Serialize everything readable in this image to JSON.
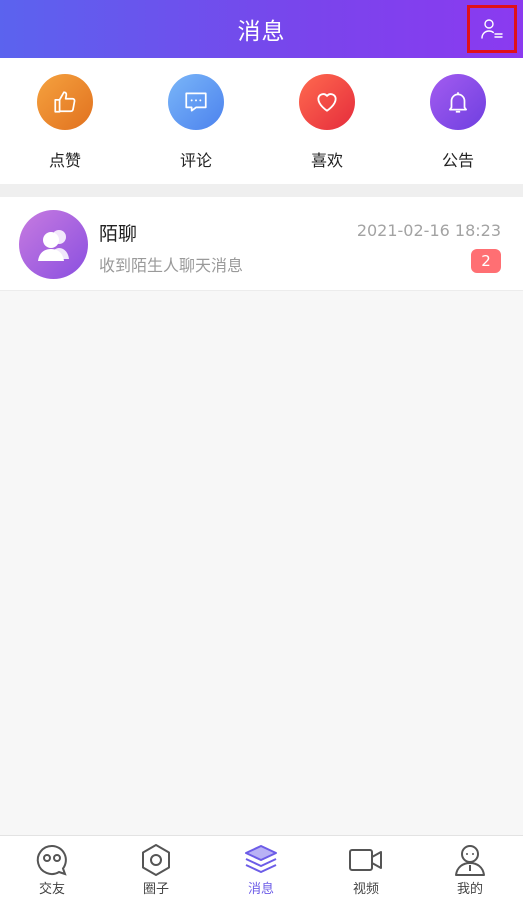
{
  "header": {
    "title": "消息"
  },
  "quick_actions": [
    {
      "label": "点赞",
      "icon": "thumbs-up-icon",
      "color": "#ef8a2e"
    },
    {
      "label": "评论",
      "icon": "comment-icon",
      "color": "#5b9cf5"
    },
    {
      "label": "喜欢",
      "icon": "heart-icon",
      "color": "#f2453d"
    },
    {
      "label": "公告",
      "icon": "bell-icon",
      "color": "#8b4be8"
    }
  ],
  "messages": [
    {
      "title": "陌聊",
      "subtitle": "收到陌生人聊天消息",
      "time": "2021-02-16 18:23",
      "badge": "2",
      "icon": "users-icon"
    }
  ],
  "tabbar": {
    "items": [
      {
        "label": "交友",
        "icon": "chat-face-icon",
        "active": false
      },
      {
        "label": "圈子",
        "icon": "hexagon-icon",
        "active": false
      },
      {
        "label": "消息",
        "icon": "layers-icon",
        "active": true
      },
      {
        "label": "视频",
        "icon": "video-camera-icon",
        "active": false
      },
      {
        "label": "我的",
        "icon": "profile-icon",
        "active": false
      }
    ],
    "active_color": "#6c5ce7",
    "inactive_color": "#444444"
  },
  "colors": {
    "header_start": "#5b63ee",
    "header_end": "#8b3af0",
    "badge": "#ff6f73",
    "highlight_border": "#e0101a"
  }
}
